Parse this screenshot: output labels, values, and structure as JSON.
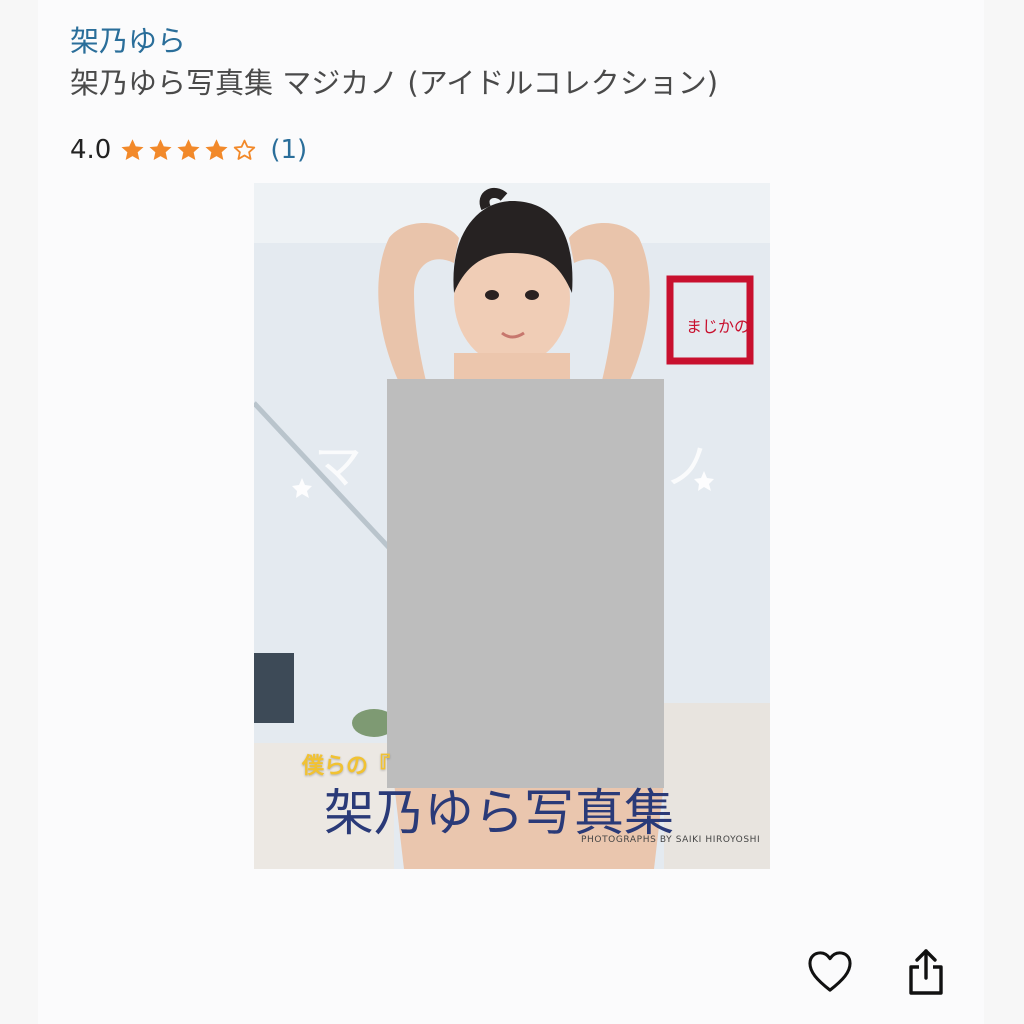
{
  "product": {
    "author": "架乃ゆら",
    "title": "架乃ゆら写真集 マジカノ (アイドルコレクション)",
    "rating_value": "4.0",
    "rating_stars": 4,
    "rating_count": "(1)"
  },
  "cover": {
    "brand_text": "まじかの",
    "subtitle_fragment": "僕らの『",
    "title_text": "架乃ゆら写真集",
    "credit_text": "PHOTOGRAPHS BY SAIKI HIROYOSHI",
    "censored": true
  },
  "actions": {
    "favorite_icon": "heart-icon",
    "share_icon": "share-icon"
  },
  "colors": {
    "link": "#2a6e9a",
    "star": "#f2892a",
    "brand_red": "#c8102e"
  }
}
